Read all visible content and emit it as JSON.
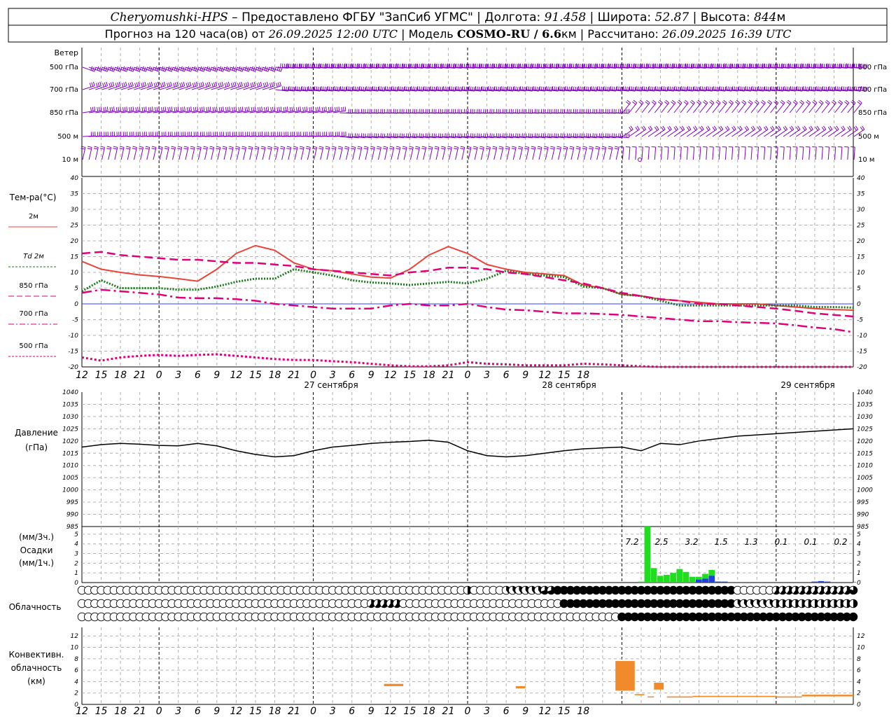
{
  "header": {
    "station": "Cheryomushki-HPS",
    "provider": " – Предоставлено ФГБУ \"ЗапСиб УГМС\" | Долгота: ",
    "lon": "91.458",
    "lat_label": " | Широта: ",
    "lat": "52.87",
    "alt_label": " | Высота: ",
    "alt": "844",
    "alt_unit": "м",
    "line2_a": "Прогноз на 120 часа(ов) от ",
    "run_time": "26.09.2025 12:00 UTC",
    "line2_b": " | Модель ",
    "model": "COSMO-RU / 6.6",
    "model_unit": "км",
    "line2_c": " | Рассчитано: ",
    "calc_time": "26.09.2025 16:39 UTC"
  },
  "wind_panel": {
    "title": "Ветер",
    "levels": [
      "500 гПа",
      "700 гПа",
      "850 гПа",
      "500 м",
      "10 м"
    ],
    "color": "#8000c0"
  },
  "temp_panel": {
    "title": "Тем-ра(°С)",
    "legend": [
      {
        "label": "2м",
        "color": "#e8443a",
        "style": "solid"
      },
      {
        "label": "Td 2м",
        "color": "#1a7a1a",
        "style": "dotted"
      },
      {
        "label": "850 гПа",
        "color": "#e0007a",
        "style": "dash"
      },
      {
        "label": "700 гПа",
        "color": "#e0007a",
        "style": "dashdot"
      },
      {
        "label": "500 гПа",
        "color": "#e0007a",
        "style": "dotted"
      }
    ],
    "yticks": [
      "40",
      "35",
      "30",
      "25",
      "20",
      "15",
      "10",
      "5",
      "0",
      "-5",
      "-10",
      "-15",
      "-20"
    ]
  },
  "x_axis": {
    "hour_labels": [
      "12",
      "15",
      "18",
      "21",
      "0",
      "3",
      "6",
      "9",
      "12",
      "15",
      "18",
      "21",
      "0",
      "3",
      "6",
      "9",
      "12",
      "15",
      "18",
      "21",
      "0",
      "3",
      "6",
      "9",
      "12",
      "15",
      "18"
    ],
    "days": [
      "27 сентября",
      "28 сентября",
      "29 сентября"
    ]
  },
  "pressure_panel": {
    "title": "Давление",
    "unit": "(гПа)",
    "yticks": [
      "1040",
      "1035",
      "1030",
      "1025",
      "1020",
      "1015",
      "1010",
      "1005",
      "1000",
      "995",
      "990",
      "985"
    ]
  },
  "precip_panel": {
    "unit_3h": "(мм/3ч.)",
    "title": "Осадки",
    "unit_1h": "(мм/1ч.)",
    "yticks": [
      "5",
      "4",
      "3",
      "2",
      "1",
      "0"
    ],
    "totals": [
      "7.2",
      "2.5",
      "3.2",
      "1.5",
      "1.3",
      "0.1",
      "0.1",
      "0.2"
    ]
  },
  "cloud_panel": {
    "title": "Облачность"
  },
  "conv_panel": {
    "title_1": "Конвективн.",
    "title_2": "облачность",
    "unit": "(км)",
    "yticks": [
      "12",
      "10",
      "8",
      "6",
      "4",
      "2",
      "0"
    ]
  },
  "chart_data": [
    {
      "type": "line",
      "title": "Тем-ра(°С)",
      "x_hours": [
        0,
        3,
        6,
        9,
        12,
        15,
        18,
        21,
        24,
        27,
        30,
        33,
        36,
        39,
        42,
        45,
        48,
        51,
        54,
        57,
        60,
        63,
        66,
        69,
        72,
        75,
        78,
        81,
        84,
        87,
        90,
        93,
        96,
        99,
        102,
        105,
        108,
        111,
        114,
        117,
        120
      ],
      "ylim": [
        -20,
        40
      ],
      "series": [
        {
          "name": "2м",
          "values": [
            13.5,
            11,
            10,
            9.2,
            8.7,
            8,
            7.2,
            11,
            16,
            18.5,
            17,
            13,
            11,
            10.5,
            9.5,
            8.5,
            8.2,
            11,
            15.5,
            18.2,
            16,
            12.5,
            11,
            10,
            9.5,
            9,
            6,
            5,
            3,
            2.5,
            1.5,
            1,
            0.5,
            0,
            0,
            0,
            -0.5,
            -1,
            -1.5,
            -1.8,
            -2
          ]
        },
        {
          "name": "Td 2м",
          "values": [
            4,
            7.5,
            5,
            5,
            5,
            4.5,
            4.5,
            5.5,
            7,
            8,
            8,
            11,
            10,
            9,
            7.5,
            6.8,
            6.5,
            6,
            6.5,
            7,
            6.5,
            8,
            10.5,
            9.5,
            9,
            8.5,
            5.5,
            5,
            3,
            2.5,
            1,
            -0.5,
            -0.5,
            -0.5,
            -0.5,
            -0.5,
            -0.5,
            -0.5,
            -1,
            -1,
            -1.2
          ]
        },
        {
          "name": "850 гПа",
          "values": [
            16,
            16.5,
            15.5,
            15,
            14.5,
            14,
            14,
            13.5,
            13,
            13,
            12.5,
            12,
            11,
            10.5,
            10,
            9.5,
            9,
            10,
            10.5,
            11.5,
            11.5,
            11,
            10,
            9.5,
            8.5,
            7.5,
            6.5,
            5,
            3.5,
            2.5,
            1.5,
            1,
            0,
            0,
            -0.5,
            -1,
            -1.5,
            -2.2,
            -3,
            -3.5,
            -4
          ]
        },
        {
          "name": "700 гПа",
          "values": [
            3.5,
            4.5,
            4,
            3.5,
            3,
            2,
            1.8,
            1.8,
            1.5,
            1,
            0,
            -0.5,
            -1,
            -1.5,
            -1.5,
            -1.5,
            -0.5,
            0,
            -0.5,
            -0.5,
            0,
            -1,
            -1.8,
            -2,
            -2.5,
            -3,
            -3,
            -3.2,
            -3.5,
            -4,
            -4.5,
            -5,
            -5.5,
            -5.5,
            -5.8,
            -6,
            -6.2,
            -6.8,
            -7.5,
            -8,
            -9
          ]
        },
        {
          "name": "500 гПа",
          "values": [
            -17,
            -18,
            -17,
            -16.5,
            -16.2,
            -16.5,
            -16.2,
            -16,
            -16.5,
            -17,
            -17.5,
            -17.8,
            -17.8,
            -18.2,
            -18.5,
            -19,
            -19.5,
            -19.8,
            -19.8,
            -19.5,
            -18.5,
            -19,
            -19.2,
            -19.5,
            -19.5,
            -19.5,
            -19,
            -19.2,
            -19.5,
            -19.8,
            -20,
            -20,
            -20,
            -20,
            -20,
            -20,
            -20,
            -20,
            -20,
            -20,
            -20
          ]
        }
      ]
    },
    {
      "type": "line",
      "title": "Давление",
      "ylabel": "(гПа)",
      "ylim": [
        985,
        1040
      ],
      "x_hours": [
        0,
        3,
        6,
        9,
        12,
        15,
        18,
        21,
        24,
        27,
        30,
        33,
        36,
        39,
        42,
        45,
        48,
        51,
        54,
        57,
        60,
        63,
        66,
        69,
        72,
        75,
        78,
        80,
        81,
        84,
        87,
        90,
        93,
        96,
        99,
        102,
        105,
        108,
        111,
        114,
        117,
        120
      ],
      "series": [
        {
          "name": "",
          "values": [
            1017.5,
            1018.5,
            1019,
            1018.7,
            1018.2,
            1018,
            1019,
            1018,
            1016,
            1014.5,
            1013.5,
            1014,
            1016,
            1017.5,
            1018.2,
            1019,
            1019.5,
            1019.8,
            1020.3,
            1019.5,
            1016,
            1014,
            1013.5,
            1014,
            1015,
            1016,
            1016.8,
            1017,
            1017.2,
            1017.5,
            1016,
            1019,
            1018.5,
            1020,
            1021,
            1022,
            1022.5,
            1023,
            1023.5,
            1024,
            1024.5,
            1025
          ]
        }
      ]
    },
    {
      "type": "bar",
      "title": "Осадки",
      "ylabel": "(мм/3ч.)",
      "ylim": [
        0,
        5.5
      ],
      "x_hours": [
        87,
        88,
        89,
        90,
        91,
        92,
        93,
        94,
        95,
        96,
        97,
        98,
        99,
        100,
        101,
        102,
        103,
        104,
        105,
        106,
        107,
        108,
        109,
        110,
        111,
        112,
        113,
        114,
        115,
        116,
        117,
        118,
        119,
        120
      ],
      "series": [
        {
          "name": "мм/3ч.",
          "values": [
            0.1,
            5.8,
            1.5,
            0.7,
            0.8,
            1.0,
            1.4,
            1.1,
            0.6,
            0.6,
            0.9,
            1.3,
            0.1,
            0,
            0,
            0,
            0,
            0,
            0,
            0,
            0,
            0,
            0,
            0,
            0,
            0,
            0,
            0,
            0,
            0,
            0,
            0,
            0,
            0
          ]
        },
        {
          "name": "мм/1ч.",
          "values": [
            0,
            0,
            0,
            0,
            0,
            0,
            0,
            0,
            0,
            0.3,
            0.4,
            0.7,
            0.1,
            0.1,
            0.05,
            0.05,
            0.05,
            0.05,
            0.05,
            0.05,
            0.05,
            0.05,
            0.05,
            0.05,
            0.05,
            0.05,
            0.05,
            0.1,
            0.15,
            0.1,
            0.05,
            0.05,
            0.05,
            0.05
          ]
        }
      ]
    },
    {
      "type": "bar",
      "title": "Конвективн. облачность",
      "ylabel": "(км)",
      "ylim": [
        0,
        13
      ],
      "bars": [
        {
          "x_start": 47,
          "x_end": 50,
          "base": 3.2,
          "top": 3.6
        },
        {
          "x_start": 67.5,
          "x_end": 69,
          "base": 2.8,
          "top": 3.2
        },
        {
          "x_start": 83,
          "x_end": 86,
          "base": 2.4,
          "top": 7.6
        },
        {
          "x_start": 86,
          "x_end": 87.5,
          "base": 1.6,
          "top": 1.8
        },
        {
          "x_start": 88,
          "x_end": 89,
          "base": 1.3,
          "top": 1.4
        },
        {
          "x_start": 89,
          "x_end": 90.5,
          "base": 2.6,
          "top": 3.8
        },
        {
          "x_start": 91,
          "x_end": 95,
          "base": 1.2,
          "top": 1.4
        },
        {
          "x_start": 95,
          "x_end": 108,
          "base": 1.3,
          "top": 1.5
        },
        {
          "x_start": 108,
          "x_end": 112,
          "base": 1.2,
          "top": 1.4
        },
        {
          "x_start": 112,
          "x_end": 120,
          "base": 1.4,
          "top": 1.7
        }
      ]
    }
  ]
}
